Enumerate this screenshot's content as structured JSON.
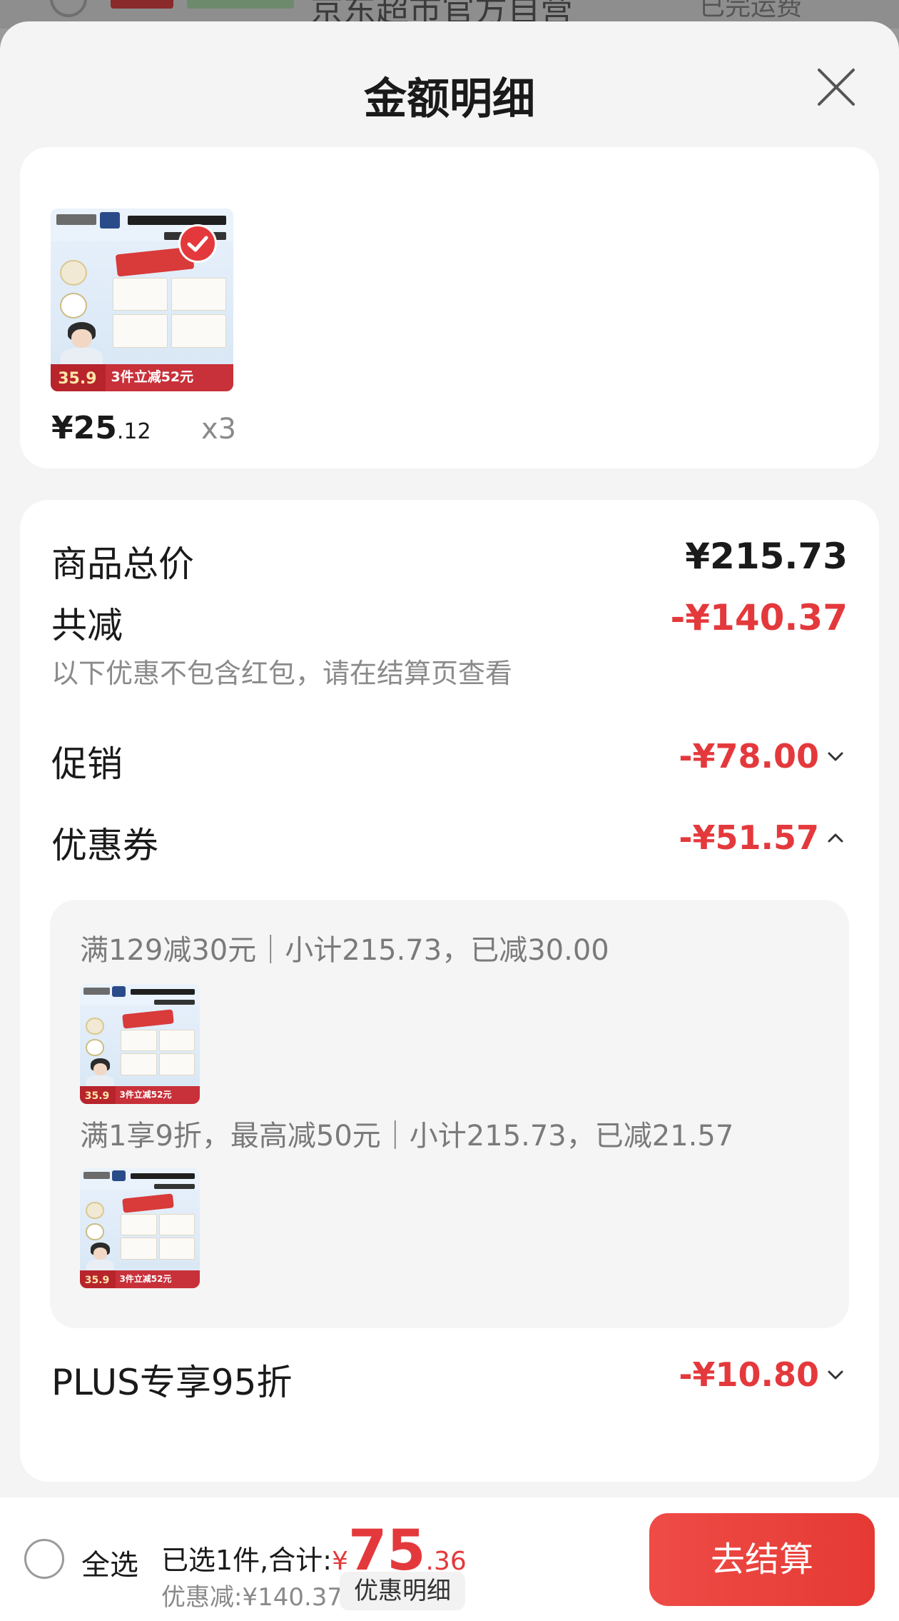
{
  "background": {
    "store_name": "京东超市官方自营",
    "right_text": "已完运费"
  },
  "sheet": {
    "title": "金额明细",
    "close_icon": "close-icon"
  },
  "product": {
    "image_bottom_price": "35.9",
    "image_bottom_text": "3件立减52元",
    "price_int": "¥25",
    "price_dec": ".12",
    "quantity": "x3",
    "selected": true
  },
  "detail": {
    "total_label": "商品总价",
    "total_value": "¥215.73",
    "reduce_label": "共减",
    "reduce_value": "-¥140.37",
    "reduce_note": "以下优惠不包含红包，请在结算页查看",
    "promo_label": "促销",
    "promo_value": "-¥78.00",
    "coupon_label": "优惠券",
    "coupon_value": "-¥51.57",
    "coupons": [
      {
        "text": "满129减30元｜小计215.73，已减30.00"
      },
      {
        "text": "满1享9折，最高减50元｜小计215.73，已减21.57"
      }
    ],
    "plus_label": "PLUS专享95折",
    "plus_value": "-¥10.80"
  },
  "footer": {
    "select_all": "全选",
    "selected_text": "已选1件,合计:",
    "currency": "¥",
    "total_int": "75",
    "total_dec": ".36",
    "saved_text": "优惠减:¥140.37",
    "detail_chip": "优惠明细",
    "checkout": "去结算"
  },
  "colors": {
    "accent_red": "#e4393c",
    "sheet_bg": "#f4f4f4",
    "card_bg": "#ffffff"
  }
}
